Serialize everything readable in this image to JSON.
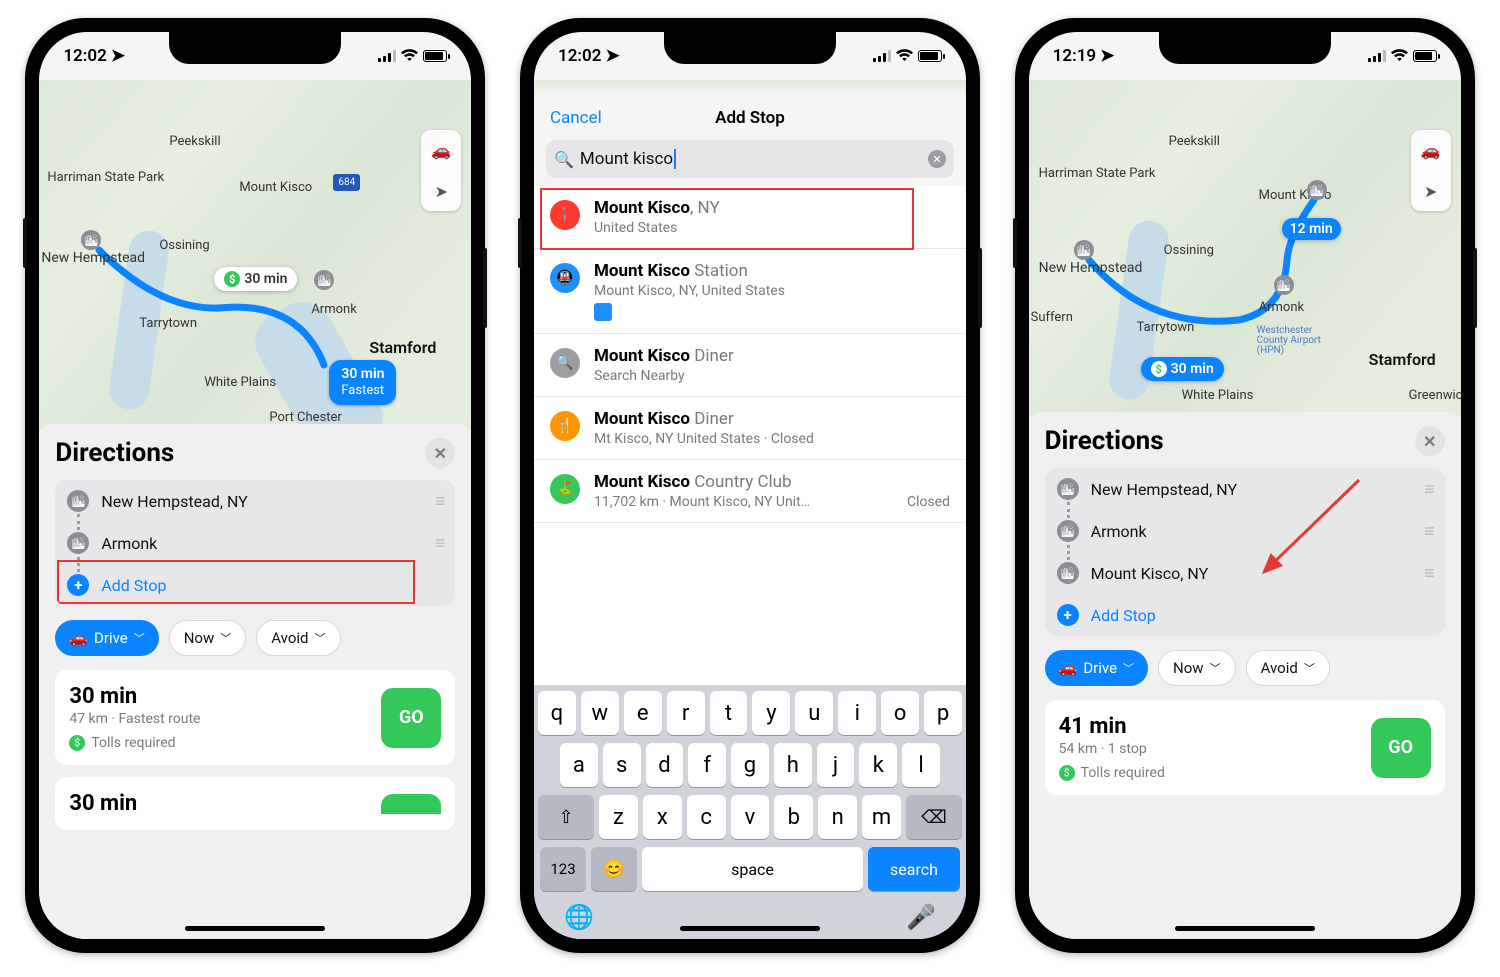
{
  "status": {
    "time1": "12:02",
    "time2": "12:02",
    "time3": "12:19"
  },
  "map_common": {
    "locations": [
      "Harriman State Park",
      "Peekskill",
      "Mount Kisco",
      "New Hempstead",
      "Ossining",
      "Armonk",
      "Tarrytown",
      "Stamford",
      "White Plains",
      "Port Chester",
      "Greenwich",
      "Suffern",
      "Westchester County Airport (HPN)"
    ],
    "highway": "684",
    "toll_badge": "30 min",
    "fastest_time": "30 min",
    "fastest_label": "Fastest",
    "mini_badge1": "12 min",
    "mini_badge2": "30 min"
  },
  "phone1": {
    "title": "Directions",
    "stops": [
      "New Hempstead, NY",
      "Armonk"
    ],
    "add": "Add Stop",
    "mode": "Drive",
    "now": "Now",
    "avoid": "Avoid",
    "route": {
      "time": "30 min",
      "dist": "47 km · Fastest route",
      "tolls": "Tolls required",
      "go": "GO"
    },
    "route2_time": "30 min"
  },
  "phone2": {
    "cancel": "Cancel",
    "title": "Add Stop",
    "query": "Mount kisco",
    "results": [
      {
        "icon": "pin",
        "color": "#ff3b30",
        "bold": "Mount Kisco",
        "rest": ", NY",
        "sub": "United States"
      },
      {
        "icon": "transit",
        "color": "#1e90ff",
        "bold": "Mount Kisco",
        "rest": " Station",
        "sub": "Mount Kisco, NY, United States"
      },
      {
        "icon": "search",
        "color": "#9d9da2",
        "bold": "Mount Kisco",
        "rest": " Diner",
        "sub": "Search Nearby"
      },
      {
        "icon": "food",
        "color": "#ff9500",
        "bold": "Mount Kisco",
        "rest": " Diner",
        "sub": "Mt Kisco, NY United States · Closed"
      },
      {
        "icon": "golf",
        "color": "#34c759",
        "bold": "Mount Kisco",
        "rest": " Country Club",
        "sub": "11,702 km · Mount Kisco, NY  Unit…",
        "closed": "Closed"
      }
    ],
    "keys_r1": [
      "q",
      "w",
      "e",
      "r",
      "t",
      "y",
      "u",
      "i",
      "o",
      "p"
    ],
    "keys_r2": [
      "a",
      "s",
      "d",
      "f",
      "g",
      "h",
      "j",
      "k",
      "l"
    ],
    "keys_r3": [
      "z",
      "x",
      "c",
      "v",
      "b",
      "n",
      "m"
    ],
    "shift": "⇧",
    "back": "⌫",
    "num": "123",
    "emoji": "😊",
    "space": "space",
    "search": "search",
    "globe": "🌐",
    "mic": "🎤"
  },
  "phone3": {
    "title": "Directions",
    "stops": [
      "New Hempstead, NY",
      "Armonk",
      "Mount Kisco, NY"
    ],
    "add": "Add Stop",
    "mode": "Drive",
    "now": "Now",
    "avoid": "Avoid",
    "route": {
      "time": "41 min",
      "dist": "54 km · 1 stop",
      "tolls": "Tolls required",
      "go": "GO"
    }
  }
}
